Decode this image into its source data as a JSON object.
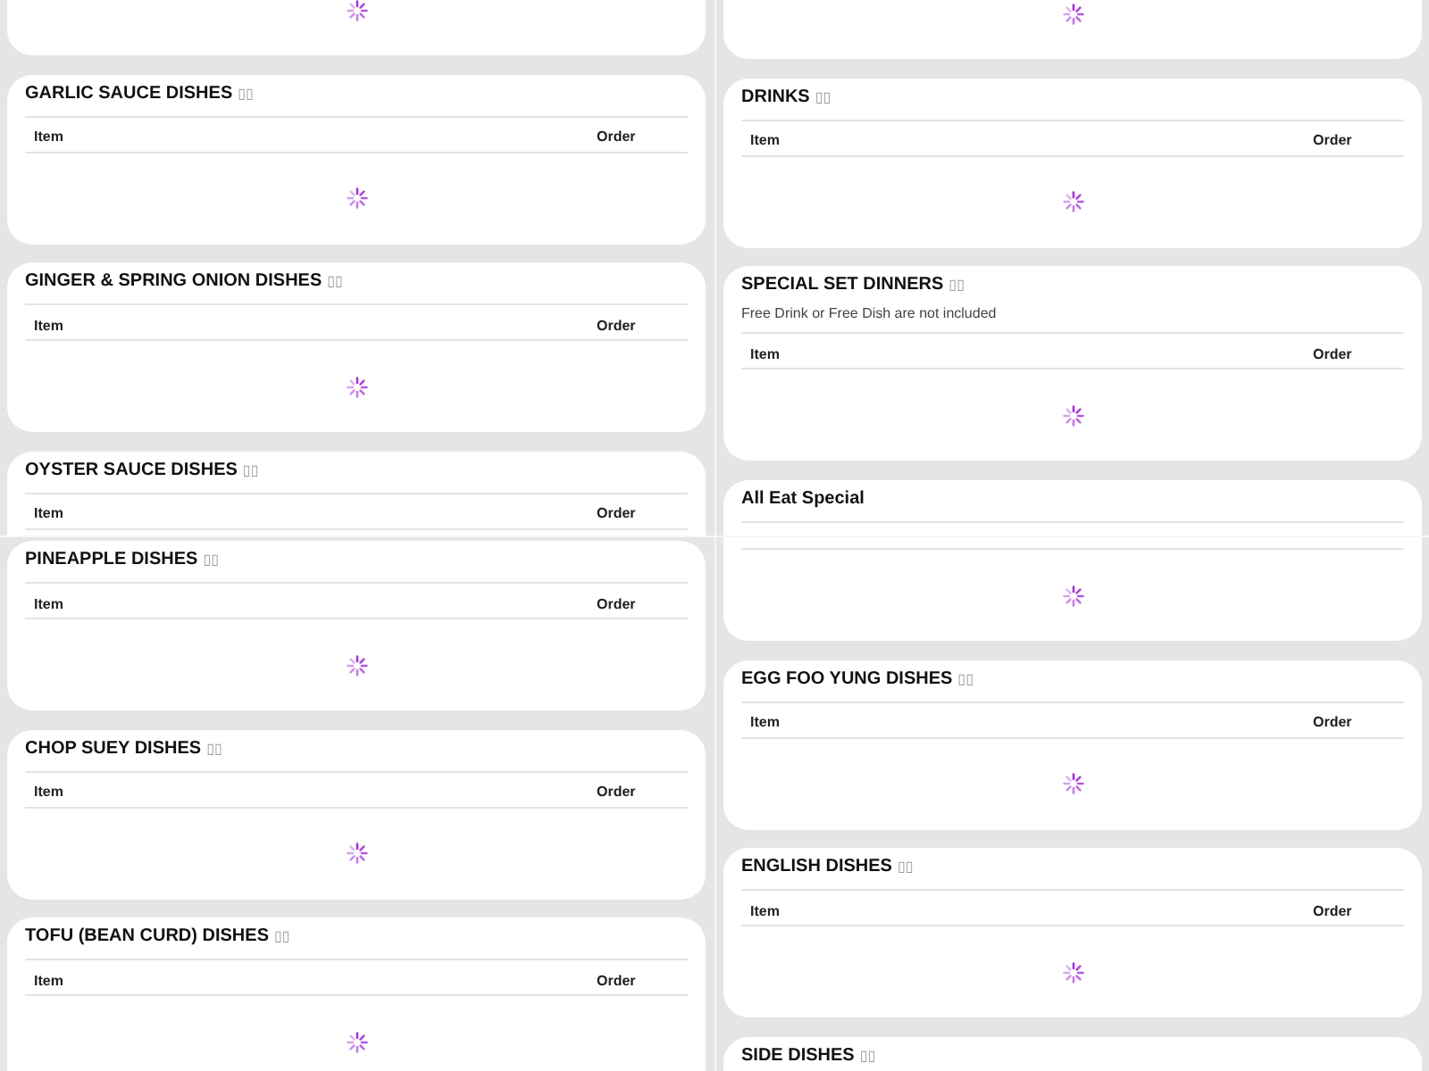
{
  "tiles": [
    {
      "cards": [
        {
          "kind": "cut_top",
          "loading": true
        },
        {
          "kind": "full",
          "title": "GARLIC SAUCE DISHES",
          "glyphs": "▯▯",
          "columns": [
            "Item",
            "Order"
          ],
          "loading": true
        },
        {
          "kind": "full",
          "title": "GINGER & SPRING ONION DISHES",
          "glyphs": "▯▯",
          "columns": [
            "Item",
            "Order"
          ],
          "loading": true
        },
        {
          "kind": "cut_bottom",
          "title": "OYSTER SAUCE DISHES",
          "glyphs": "▯▯",
          "columns": [
            "Item",
            "Order"
          ]
        }
      ]
    },
    {
      "cards": [
        {
          "kind": "cut_top",
          "loading": true
        },
        {
          "kind": "full",
          "title": "DRINKS",
          "glyphs": "▯▯",
          "columns": [
            "Item",
            "Order"
          ],
          "loading": true
        },
        {
          "kind": "full",
          "title": "SPECIAL SET DINNERS",
          "glyphs": "▯▯",
          "note": "Free Drink or Free Dish are not included",
          "columns": [
            "Item",
            "Order"
          ],
          "loading": true
        },
        {
          "kind": "cut_bottom",
          "title": "All Eat Special"
        }
      ]
    },
    {
      "cards": [
        {
          "kind": "full",
          "title": "PINEAPPLE DISHES",
          "glyphs": "▯▯",
          "columns": [
            "Item",
            "Order"
          ],
          "loading": true
        },
        {
          "kind": "full",
          "title": "CHOP SUEY DISHES",
          "glyphs": "▯▯",
          "columns": [
            "Item",
            "Order"
          ],
          "loading": true
        },
        {
          "kind": "cut_bottom",
          "title": "TOFU (BEAN CURD) DISHES",
          "glyphs": "▯▯",
          "columns": [
            "Item",
            "Order"
          ],
          "loading": true
        }
      ]
    },
    {
      "cards": [
        {
          "kind": "cut_top",
          "loading": true
        },
        {
          "kind": "full",
          "title": "EGG FOO YUNG DISHES",
          "glyphs": "▯▯",
          "columns": [
            "Item",
            "Order"
          ],
          "loading": true
        },
        {
          "kind": "full",
          "title": "ENGLISH DISHES",
          "glyphs": "▯▯",
          "columns": [
            "Item",
            "Order"
          ],
          "loading": true
        },
        {
          "kind": "cut_bottom",
          "title": "SIDE DISHES",
          "glyphs": "▯▯"
        }
      ]
    }
  ]
}
